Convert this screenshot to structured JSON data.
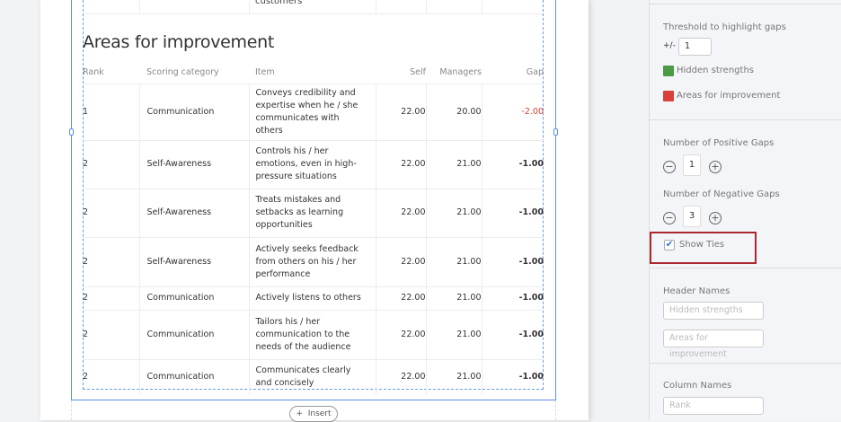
{
  "report": {
    "prev_row_text": "customers",
    "section_title": "Areas for improvement",
    "columns": [
      "Rank",
      "Scoring category",
      "Item",
      "Self",
      "Managers",
      "Gap"
    ],
    "rows": [
      {
        "rank": "1",
        "category": "Communication",
        "item": "Conveys credibility and expertise when he / she communicates with others",
        "self": "22.00",
        "managers": "20.00",
        "gap": "-2.00",
        "highlight": true
      },
      {
        "rank": "2",
        "category": "Self-Awareness",
        "item": "Controls his / her emotions, even in high-pressure situations",
        "self": "22.00",
        "managers": "21.00",
        "gap": "-1.00"
      },
      {
        "rank": "2",
        "category": "Self-Awareness",
        "item": "Treats mistakes and setbacks as learning opportunities",
        "self": "22.00",
        "managers": "21.00",
        "gap": "-1.00"
      },
      {
        "rank": "2",
        "category": "Self-Awareness",
        "item": "Actively seeks feedback from others on his / her performance",
        "self": "22.00",
        "managers": "21.00",
        "gap": "-1.00"
      },
      {
        "rank": "2",
        "category": "Communication",
        "item": "Actively listens to others",
        "self": "22.00",
        "managers": "21.00",
        "gap": "-1.00"
      },
      {
        "rank": "2",
        "category": "Communication",
        "item": "Tailors his / her communication to the needs of the audience",
        "self": "22.00",
        "managers": "21.00",
        "gap": "-1.00"
      },
      {
        "rank": "2",
        "category": "Communication",
        "item": "Communicates clearly and concisely",
        "self": "22.00",
        "managers": "21.00",
        "gap": "-1.00"
      }
    ],
    "insert_label": "Insert"
  },
  "panel": {
    "threshold_label": "Threshold to highlight gaps",
    "threshold_prefix": "+/-",
    "threshold_value": "1",
    "legend": [
      {
        "label": "Hidden strengths",
        "color": "#4a9a46"
      },
      {
        "label": "Areas for improvement",
        "color": "#d9403a"
      }
    ],
    "positive_label": "Number of Positive Gaps",
    "positive_value": "1",
    "negative_label": "Number of Negative Gaps",
    "negative_value": "3",
    "show_ties_label": "Show Ties",
    "show_ties_checked": true,
    "header_names_label": "Header Names",
    "header_placeholder_1": "Hidden strengths",
    "header_placeholder_2": "Areas for improvement",
    "column_names_label": "Column Names",
    "column_placeholder_1": "Rank"
  }
}
